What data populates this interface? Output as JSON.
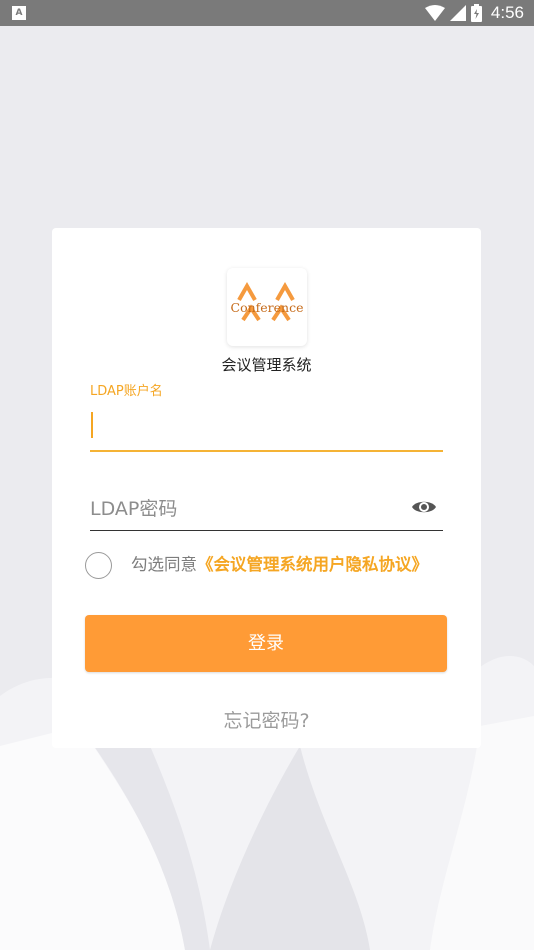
{
  "status_bar": {
    "left_icon": "A",
    "time": "4:56",
    "icons": [
      "wifi-icon",
      "signal-icon",
      "battery-icon"
    ]
  },
  "logo": {
    "wordmark": "Conference"
  },
  "app": {
    "name": "会议管理系统"
  },
  "login_form": {
    "account_label": "LDAP账户名",
    "account_value": "",
    "password_placeholder": "LDAP密码",
    "agree_prefix": "勾选同意",
    "agree_link": "《会议管理系统用户隐私协议》",
    "login_button": "登录",
    "forgot_password": "忘记密码?"
  },
  "colors": {
    "accent": "#f5a623",
    "button": "#ff9b36",
    "background": "#ebebef"
  }
}
